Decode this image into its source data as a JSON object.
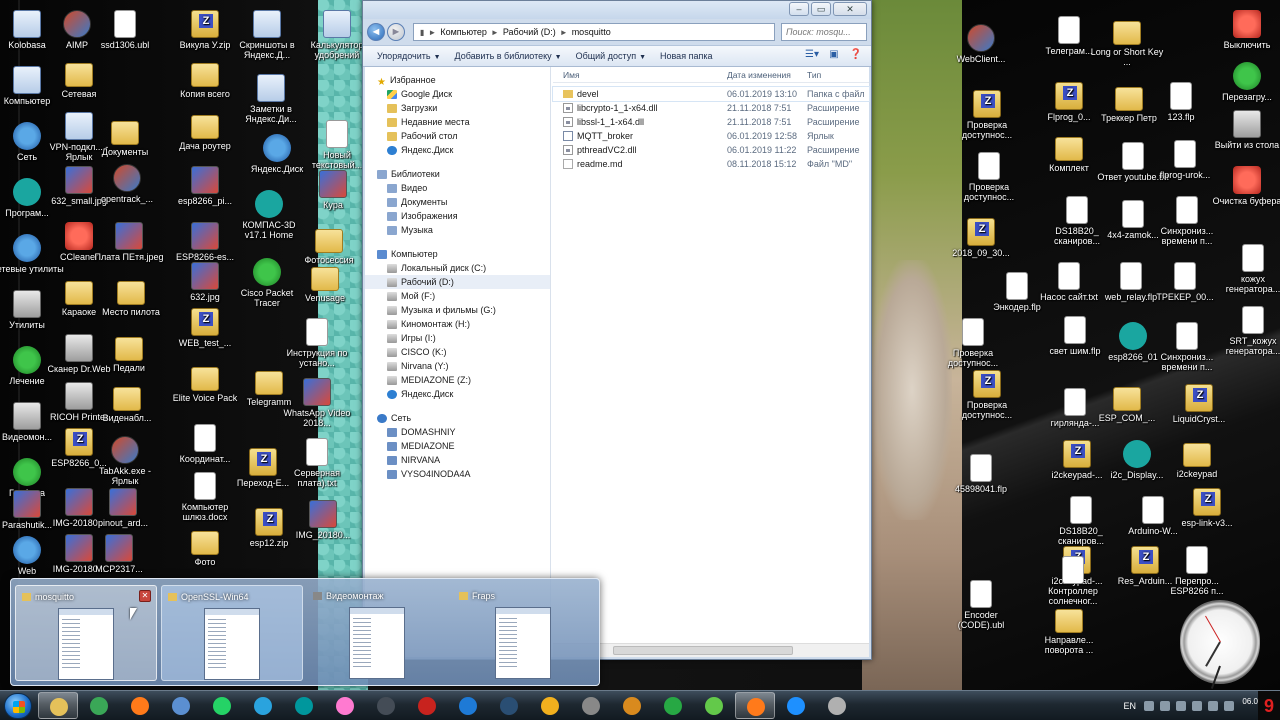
{
  "desktop_icons": [
    {
      "label": "Kolobasa",
      "kind": "shortcut"
    },
    {
      "label": "Компьютер",
      "kind": "shortcut"
    },
    {
      "label": "Сеть",
      "kind": "blue"
    },
    {
      "label": "Програм...",
      "kind": "teal"
    },
    {
      "label": "Сетевые утилиты",
      "kind": "blue"
    },
    {
      "label": "Утилиты",
      "kind": "gray"
    },
    {
      "label": "Лечение",
      "kind": "green"
    },
    {
      "label": "Видеомон...",
      "kind": "gray"
    },
    {
      "label": "Графика",
      "kind": "green"
    },
    {
      "label": "Parashutik...",
      "kind": "img"
    },
    {
      "label": "Web",
      "kind": "blue"
    },
    {
      "label": "AIMP",
      "kind": "app"
    },
    {
      "label": "Сетевая",
      "kind": "folder"
    },
    {
      "label": "VPN-подкл... - Ярлык",
      "kind": "shortcut"
    },
    {
      "label": "632_small.jpg",
      "kind": "img"
    },
    {
      "label": "CCleaner",
      "kind": "red"
    },
    {
      "label": "Караоке",
      "kind": "folder"
    },
    {
      "label": "Сканер Dr.Web",
      "kind": "gray"
    },
    {
      "label": "RICOH Printer",
      "kind": "gray"
    },
    {
      "label": "ESP8266_0...",
      "kind": "zip"
    },
    {
      "label": "IMG-20180...",
      "kind": "img"
    },
    {
      "label": "IMG-20180...",
      "kind": "img"
    },
    {
      "label": "ssd1306.ubl",
      "kind": "doc"
    },
    {
      "label": "Документы",
      "kind": "folder"
    },
    {
      "label": "opentrack_...",
      "kind": "app"
    },
    {
      "label": "Плата ПЕтя.jpeg",
      "kind": "img"
    },
    {
      "label": "Место пилота",
      "kind": "folder"
    },
    {
      "label": "Педали",
      "kind": "folder"
    },
    {
      "label": "Виденабл...",
      "kind": "folder"
    },
    {
      "label": "TabAkk.exe - Ярлык",
      "kind": "app"
    },
    {
      "label": "pinout_ard...",
      "kind": "img"
    },
    {
      "label": "MCP2317...",
      "kind": "img"
    },
    {
      "label": "Викула У.zip",
      "kind": "zip"
    },
    {
      "label": "Копия всего",
      "kind": "folder"
    },
    {
      "label": "Дача роутер",
      "kind": "folder"
    },
    {
      "label": "esp8266_pi...",
      "kind": "img"
    },
    {
      "label": "ESP8266-es...",
      "kind": "img"
    },
    {
      "label": "632.jpg",
      "kind": "img"
    },
    {
      "label": "WEB_test_...",
      "kind": "zip"
    },
    {
      "label": "Elite Voice Pack",
      "kind": "folder"
    },
    {
      "label": "Координат...",
      "kind": "doc"
    },
    {
      "label": "Компьютер шлюз.docx",
      "kind": "doc"
    },
    {
      "label": "Фото",
      "kind": "folder"
    },
    {
      "label": "Скриншоты в Яндекс.Д...",
      "kind": "shortcut"
    },
    {
      "label": "Заметки в Яндекс.Ди...",
      "kind": "shortcut"
    },
    {
      "label": "Яндекс.Диск",
      "kind": "blue"
    },
    {
      "label": "КОМПАС-3D v17.1 Home",
      "kind": "teal"
    },
    {
      "label": "Cisco Packet Tracer",
      "kind": "green"
    },
    {
      "label": "Telegramm",
      "kind": "folder"
    },
    {
      "label": "Переход-Е...",
      "kind": "zip"
    },
    {
      "label": "esp12.zip",
      "kind": "zip"
    },
    {
      "label": "Калькулятор удобрений",
      "kind": "shortcut"
    },
    {
      "label": "Новый текстовый...",
      "kind": "doc"
    },
    {
      "label": "Кура",
      "kind": "img"
    },
    {
      "label": "Фотосессия",
      "kind": "folder"
    },
    {
      "label": "Venusage",
      "kind": "folder"
    },
    {
      "label": "Инструкция по устано...",
      "kind": "doc"
    },
    {
      "label": "WhatsApp Video 2018...",
      "kind": "img"
    },
    {
      "label": "Серверная плата).txt",
      "kind": "doc"
    },
    {
      "label": "IMG_20180...",
      "kind": "img"
    },
    {
      "label": "WebClient...",
      "kind": "app"
    },
    {
      "label": "Проверка доступнос...",
      "kind": "zip"
    },
    {
      "label": "Проверка доступнос...",
      "kind": "doc"
    },
    {
      "label": "2018_09_30...",
      "kind": "zip"
    },
    {
      "label": "Энкодер.flp",
      "kind": "doc"
    },
    {
      "label": "Проверка доступнос...",
      "kind": "doc"
    },
    {
      "label": "Проверка доступнос...",
      "kind": "zip"
    },
    {
      "label": "45898041.flp",
      "kind": "doc"
    },
    {
      "label": "Encoder (CODE).ubl",
      "kind": "doc"
    },
    {
      "label": "Телеграм...",
      "kind": "doc"
    },
    {
      "label": "Flprog_0...",
      "kind": "zip"
    },
    {
      "label": "Комплект",
      "kind": "folder"
    },
    {
      "label": "DS18B20_ сканиров...",
      "kind": "doc"
    },
    {
      "label": "Насос сайт.txt",
      "kind": "doc"
    },
    {
      "label": "свет шим.flp",
      "kind": "doc"
    },
    {
      "label": "гирлянда-...",
      "kind": "doc"
    },
    {
      "label": "i2ckeypad-...",
      "kind": "zip"
    },
    {
      "label": "DS18B20_ сканиров...",
      "kind": "doc"
    },
    {
      "label": "i2ckeypad-...",
      "kind": "zip"
    },
    {
      "label": "Направле... поворота ...",
      "kind": "folder"
    },
    {
      "label": "Контроллер солнечног...",
      "kind": "doc"
    },
    {
      "label": "Long or Short Key ...",
      "kind": "folder"
    },
    {
      "label": "Треккер Петр",
      "kind": "folder"
    },
    {
      "label": "Ответ youtube.txt",
      "kind": "doc"
    },
    {
      "label": "4x4-zamok...",
      "kind": "doc"
    },
    {
      "label": "web_relay.flp",
      "kind": "doc"
    },
    {
      "label": "esp8266_01",
      "kind": "teal"
    },
    {
      "label": "ESP_COM_...",
      "kind": "folder"
    },
    {
      "label": "i2c_Display...",
      "kind": "teal"
    },
    {
      "label": "Arduino-W...",
      "kind": "doc"
    },
    {
      "label": "Res_Arduin...",
      "kind": "zip"
    },
    {
      "label": "123.flp",
      "kind": "doc"
    },
    {
      "label": "flprog-urok...",
      "kind": "doc"
    },
    {
      "label": "Синхрониз... времени п...",
      "kind": "doc"
    },
    {
      "label": "ТРЕКЕР_00...",
      "kind": "doc"
    },
    {
      "label": "Синхрониз... времени п...",
      "kind": "doc"
    },
    {
      "label": "LiquidCryst...",
      "kind": "zip"
    },
    {
      "label": "i2ckeypad",
      "kind": "folder"
    },
    {
      "label": "esp-link-v3...",
      "kind": "zip"
    },
    {
      "label": "Перепро... ESP8266 п...",
      "kind": "doc"
    },
    {
      "label": "Выключить",
      "kind": "red"
    },
    {
      "label": "Перезагру...",
      "kind": "green"
    },
    {
      "label": "Выйти из стола",
      "kind": "gray"
    },
    {
      "label": "Очистка буфера",
      "kind": "red"
    },
    {
      "label": "кожух генератора...",
      "kind": "doc"
    },
    {
      "label": "SRT_кожух генератора...",
      "kind": "doc"
    }
  ],
  "explorer": {
    "window_buttons": {
      "minimize": "‒",
      "maximize": "▭",
      "close": "✕"
    },
    "address_crumbs": [
      "Компьютер",
      "Рабочий (D:)",
      "mosquitto"
    ],
    "search_placeholder": "Поиск: mosqu...",
    "toolbar": {
      "organize": "Упорядочить",
      "add_to_library": "Добавить в библиотеку",
      "share": "Общий доступ",
      "new_folder": "Новая папка"
    },
    "nav": {
      "favorites_head": "Избранное",
      "favorites": [
        "Google Диск",
        "Загрузки",
        "Недавние места",
        "Рабочий стол",
        "Яндекс.Диск"
      ],
      "libraries_head": "Библиотеки",
      "libraries": [
        "Видео",
        "Документы",
        "Изображения",
        "Музыка"
      ],
      "computer_head": "Компьютер",
      "drives": [
        "Локальный диск (C:)",
        "Рабочий (D:)",
        "Мой (F:)",
        "Музыка и фильмы (G:)",
        "Киномонтаж (H:)",
        "Игры (I:)",
        "CISCO (K:)",
        "Nirvana (Y:)",
        "MEDIAZONE (Z:)",
        "Яндекс.Диск"
      ],
      "network_head": "Сеть",
      "network": [
        "DOMASHNIY",
        "MEDIAZONE",
        "NIRVANA",
        "VYSO4INODA4A"
      ]
    },
    "columns": {
      "name": "Имя",
      "date": "Дата изменения",
      "type": "Тип"
    },
    "files": [
      {
        "name": "devel",
        "date": "06.01.2019 13:10",
        "type": "Папка с файл",
        "icon": "folder"
      },
      {
        "name": "libcrypto-1_1-x64.dll",
        "date": "21.11.2018 7:51",
        "type": "Расширение",
        "icon": "dll"
      },
      {
        "name": "libssl-1_1-x64.dll",
        "date": "21.11.2018 7:51",
        "type": "Расширение",
        "icon": "dll"
      },
      {
        "name": "MQTT_broker",
        "date": "06.01.2019 12:58",
        "type": "Ярлык",
        "icon": "lnk"
      },
      {
        "name": "pthreadVC2.dll",
        "date": "06.01.2019 11:22",
        "type": "Расширение",
        "icon": "dll"
      },
      {
        "name": "readme.md",
        "date": "08.11.2018 15:12",
        "type": "Файл \"MD\"",
        "icon": "md"
      }
    ]
  },
  "peek": {
    "thumbnails": [
      {
        "title": "mosquitto",
        "close": "✕"
      },
      {
        "title": "OpenSSL-Win64"
      },
      {
        "title": "Видеомонтаж"
      },
      {
        "title": "Fraps"
      }
    ]
  },
  "taskbar": {
    "lang": "EN",
    "clock": "06.0",
    "corner_digit": "9",
    "apps": [
      {
        "name": "explorer",
        "color": "#e5c15a"
      },
      {
        "name": "chrome",
        "color": "#3aa757"
      },
      {
        "name": "firefox",
        "color": "#ff7a1a"
      },
      {
        "name": "thunderbird",
        "color": "#5b8fd1"
      },
      {
        "name": "whatsapp",
        "color": "#25d366"
      },
      {
        "name": "telegram",
        "color": "#2aa3de"
      },
      {
        "name": "arduino",
        "color": "#00979d"
      },
      {
        "name": "opentrack",
        "color": "#ff7ad0"
      },
      {
        "name": "terminal",
        "color": "#444c56"
      },
      {
        "name": "filezilla",
        "color": "#c8231e"
      },
      {
        "name": "edge",
        "color": "#1e7ad6"
      },
      {
        "name": "steam",
        "color": "#2a4e73"
      },
      {
        "name": "aimp",
        "color": "#f2b01e"
      },
      {
        "name": "video-editor",
        "color": "#888"
      },
      {
        "name": "media-player",
        "color": "#d98a1e"
      },
      {
        "name": "mail-ru-agent",
        "color": "#27a844"
      },
      {
        "name": "icq",
        "color": "#63c94a"
      },
      {
        "name": "firefox-2",
        "color": "#ff7a1a"
      },
      {
        "name": "search",
        "color": "#1e90ff"
      },
      {
        "name": "app-misc",
        "color": "#b0b0b0"
      }
    ]
  }
}
